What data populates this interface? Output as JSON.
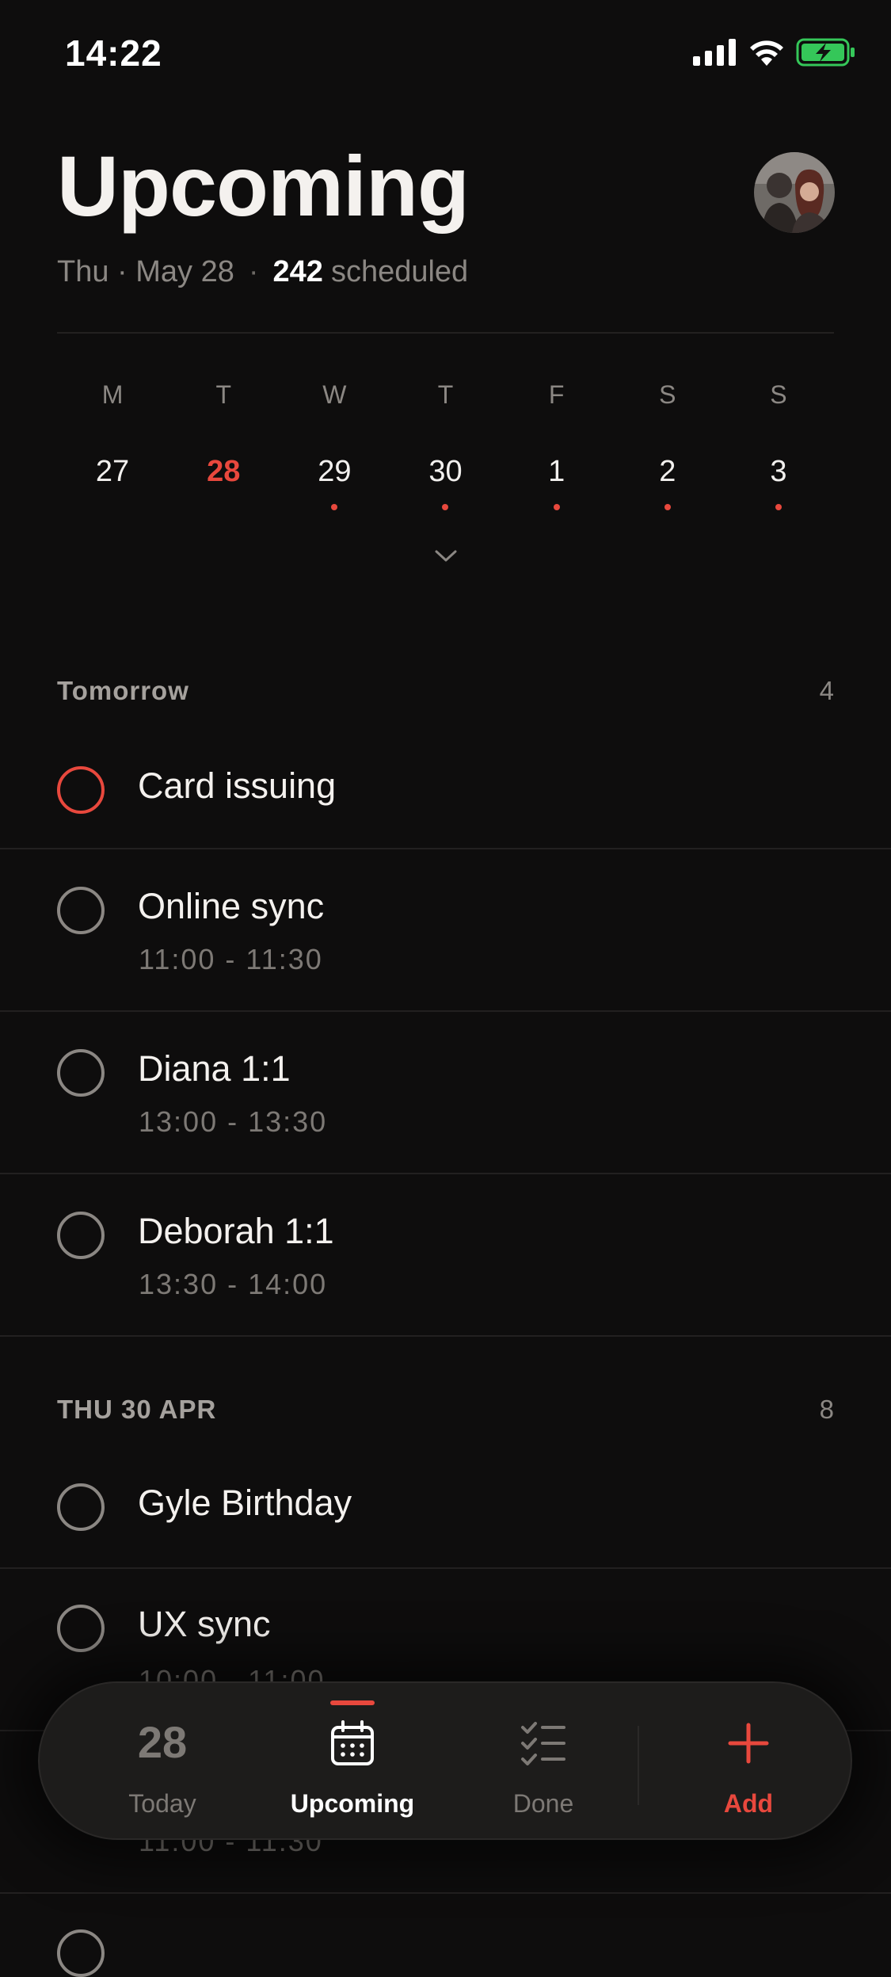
{
  "status_bar": {
    "time": "14:22"
  },
  "header": {
    "title": "Upcoming",
    "date": "Thu · May 28",
    "separator": "·",
    "scheduled_count": "242",
    "scheduled_label": "scheduled"
  },
  "week": {
    "days": [
      {
        "weekday": "M",
        "date": "27",
        "current": false,
        "has_items": false
      },
      {
        "weekday": "T",
        "date": "28",
        "current": true,
        "has_items": false
      },
      {
        "weekday": "W",
        "date": "29",
        "current": false,
        "has_items": true
      },
      {
        "weekday": "T",
        "date": "30",
        "current": false,
        "has_items": true
      },
      {
        "weekday": "F",
        "date": "1",
        "current": false,
        "has_items": true
      },
      {
        "weekday": "S",
        "date": "2",
        "current": false,
        "has_items": true
      },
      {
        "weekday": "S",
        "date": "3",
        "current": false,
        "has_items": true
      }
    ],
    "expand_icon": "chevron-down-icon"
  },
  "sections": [
    {
      "title": "Tomorrow",
      "count": "4",
      "tasks": [
        {
          "title": "Card issuing",
          "time": "",
          "priority": true
        },
        {
          "title": "Online sync",
          "time": "11:00 - 11:30",
          "priority": false
        },
        {
          "title": "Diana 1:1",
          "time": "13:00 - 13:30",
          "priority": false
        },
        {
          "title": "Deborah 1:1",
          "time": "13:30 - 14:00",
          "priority": false
        }
      ]
    },
    {
      "title": "THU 30 APR",
      "count": "8",
      "tasks": [
        {
          "title": "Gyle Birthday",
          "time": "",
          "priority": false
        },
        {
          "title": "UX sync",
          "time": "10:00 - 11:00",
          "priority": false
        },
        {
          "title": "",
          "time": "11:00 - 11:30",
          "priority": false
        }
      ]
    }
  ],
  "tab_bar": {
    "today_number": "28",
    "today_label": "Today",
    "upcoming_label": "Upcoming",
    "done_label": "Done",
    "add_label": "Add",
    "active_tab": "Upcoming"
  },
  "colors": {
    "background": "#0e0d0d",
    "accent": "#e8483d",
    "text_primary": "#f4f1ee",
    "text_secondary": "#8b8783",
    "battery": "#35c759"
  }
}
